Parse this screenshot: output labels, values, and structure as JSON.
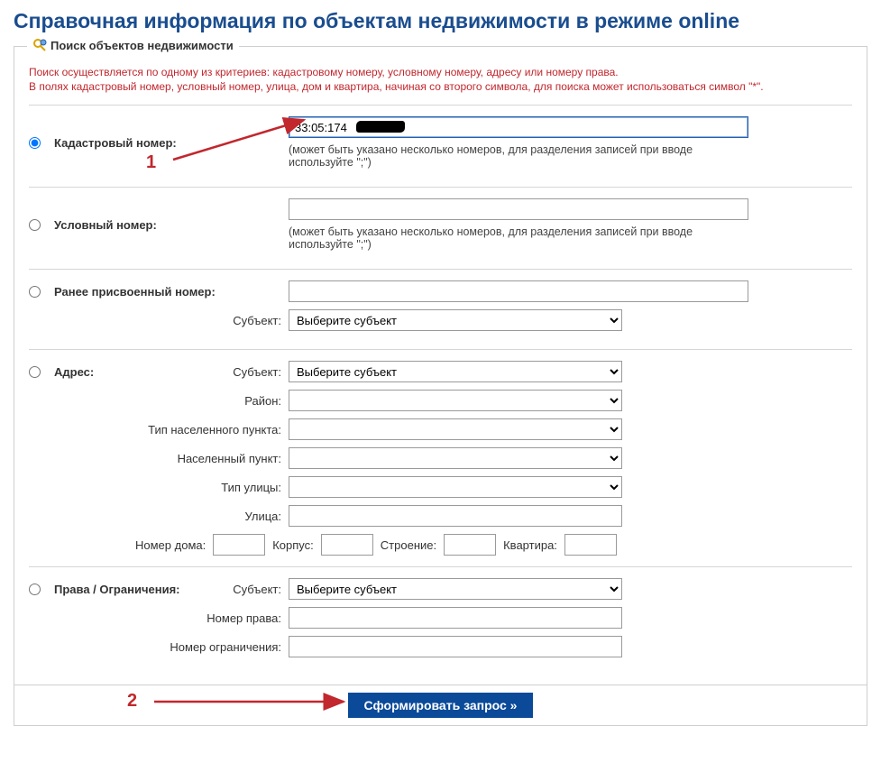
{
  "page": {
    "title": "Справочная информация по объектам недвижимости в режиме online"
  },
  "panel": {
    "legend": "Поиск объектов недвижимости",
    "warning_line1": "Поиск осуществляется по одному из критериев: кадастровому номеру, условному номеру, адресу или номеру права.",
    "warning_line2": "В полях кадастровый номер, условный номер, улица, дом и квартира, начиная со второго символа, для поиска может использоваться символ \"*\"."
  },
  "cadastral": {
    "label": "Кадастровый номер:",
    "value": "33:05:174",
    "hint": "(может быть указано несколько номеров, для разделения записей при вводе используйте \";\")"
  },
  "conditional": {
    "label": "Условный номер:",
    "value": "",
    "hint": "(может быть указано несколько номеров, для разделения записей при вводе используйте \";\")"
  },
  "prev_assigned": {
    "label": "Ранее присвоенный номер:",
    "value": "",
    "subject_label": "Субъект:",
    "subject_value": "Выберите субъект"
  },
  "address": {
    "label": "Адрес:",
    "subject_label": "Субъект:",
    "subject_value": "Выберите субъект",
    "district_label": "Район:",
    "district_value": "",
    "settlement_type_label": "Тип населенного пункта:",
    "settlement_type_value": "",
    "settlement_label": "Населенный пункт:",
    "settlement_value": "",
    "street_type_label": "Тип улицы:",
    "street_type_value": "",
    "street_label": "Улица:",
    "street_value": "",
    "house_label": "Номер дома:",
    "house_value": "",
    "korpus_label": "Корпус:",
    "korpus_value": "",
    "building_label": "Строение:",
    "building_value": "",
    "flat_label": "Квартира:",
    "flat_value": ""
  },
  "rights": {
    "label": "Права / Ограничения:",
    "subject_label": "Субъект:",
    "subject_value": "Выберите субъект",
    "right_number_label": "Номер права:",
    "right_number_value": "",
    "restriction_label": "Номер ограничения:",
    "restriction_value": ""
  },
  "submit": {
    "label": "Сформировать запрос »"
  },
  "annotations": {
    "one": "1",
    "two": "2"
  }
}
